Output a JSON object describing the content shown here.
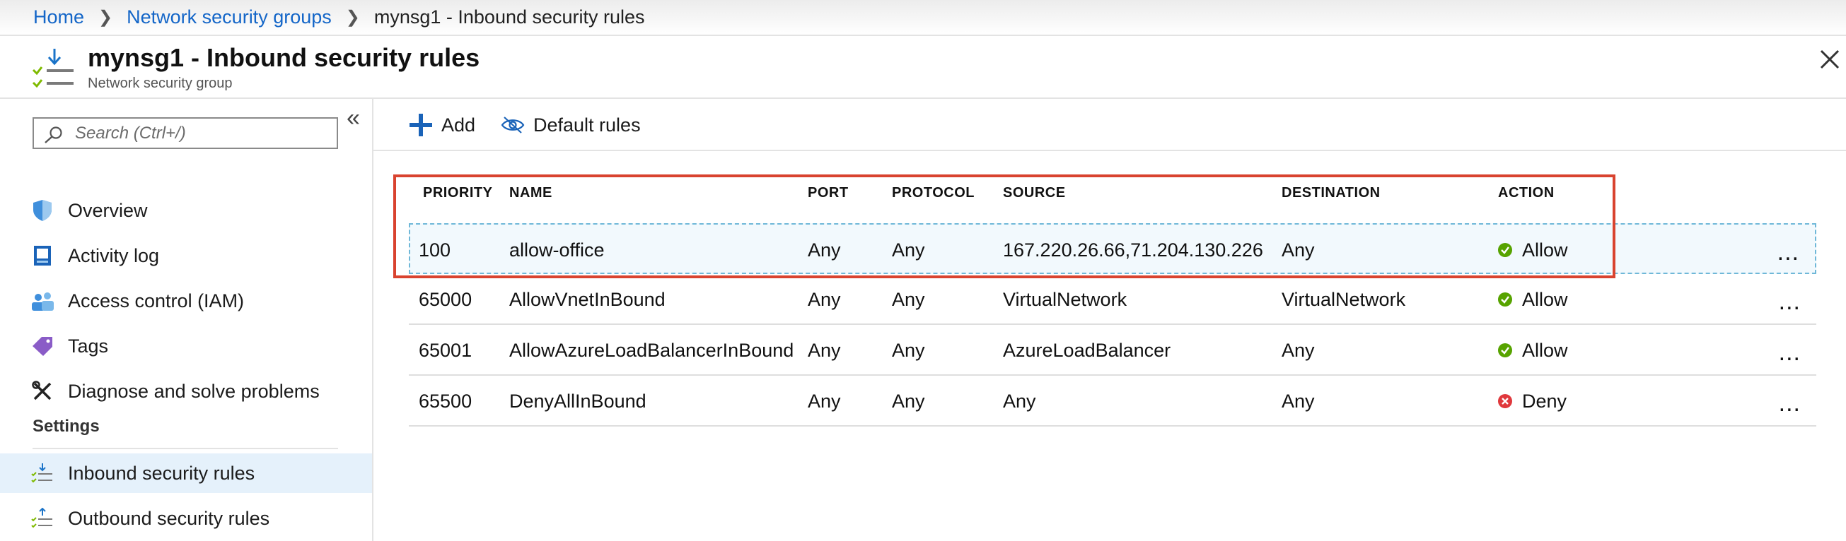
{
  "breadcrumb": {
    "home": "Home",
    "parent": "Network security groups",
    "current": "mynsg1 - Inbound security rules"
  },
  "header": {
    "title": "mynsg1 - Inbound security rules",
    "subtitle": "Network security group"
  },
  "sidebar": {
    "search_placeholder": "Search (Ctrl+/)",
    "items": [
      {
        "label": "Overview",
        "icon": "shield-icon"
      },
      {
        "label": "Activity log",
        "icon": "activity-log-icon"
      },
      {
        "label": "Access control (IAM)",
        "icon": "people-icon"
      },
      {
        "label": "Tags",
        "icon": "tag-icon"
      },
      {
        "label": "Diagnose and solve problems",
        "icon": "wrench-icon"
      }
    ],
    "section_label": "Settings",
    "settings_items": [
      {
        "label": "Inbound security rules",
        "icon": "inbound-rules-icon",
        "selected": true
      },
      {
        "label": "Outbound security rules",
        "icon": "outbound-rules-icon",
        "selected": false
      }
    ]
  },
  "toolbar": {
    "add_label": "Add",
    "default_rules_label": "Default rules"
  },
  "table": {
    "headers": [
      "PRIORITY",
      "NAME",
      "PORT",
      "PROTOCOL",
      "SOURCE",
      "DESTINATION",
      "ACTION"
    ],
    "rows": [
      {
        "priority": "100",
        "name": "allow-office",
        "port": "Any",
        "protocol": "Any",
        "source": "167.220.26.66,71.204.130.226",
        "destination": "Any",
        "action": "Allow",
        "more": "..."
      },
      {
        "priority": "65000",
        "name": "AllowVnetInBound",
        "port": "Any",
        "protocol": "Any",
        "source": "VirtualNetwork",
        "destination": "VirtualNetwork",
        "action": "Allow",
        "more": "..."
      },
      {
        "priority": "65001",
        "name": "AllowAzureLoadBalancerInBound",
        "port": "Any",
        "protocol": "Any",
        "source": "AzureLoadBalancer",
        "destination": "Any",
        "action": "Allow",
        "more": "..."
      },
      {
        "priority": "65500",
        "name": "DenyAllInBound",
        "port": "Any",
        "protocol": "Any",
        "source": "Any",
        "destination": "Any",
        "action": "Deny",
        "more": "..."
      }
    ]
  },
  "colors": {
    "link": "#1466c8",
    "allow": "#57a300",
    "deny": "#e0383c",
    "highlight_border": "#d9432f",
    "selected_bg": "#e5f1fb"
  }
}
